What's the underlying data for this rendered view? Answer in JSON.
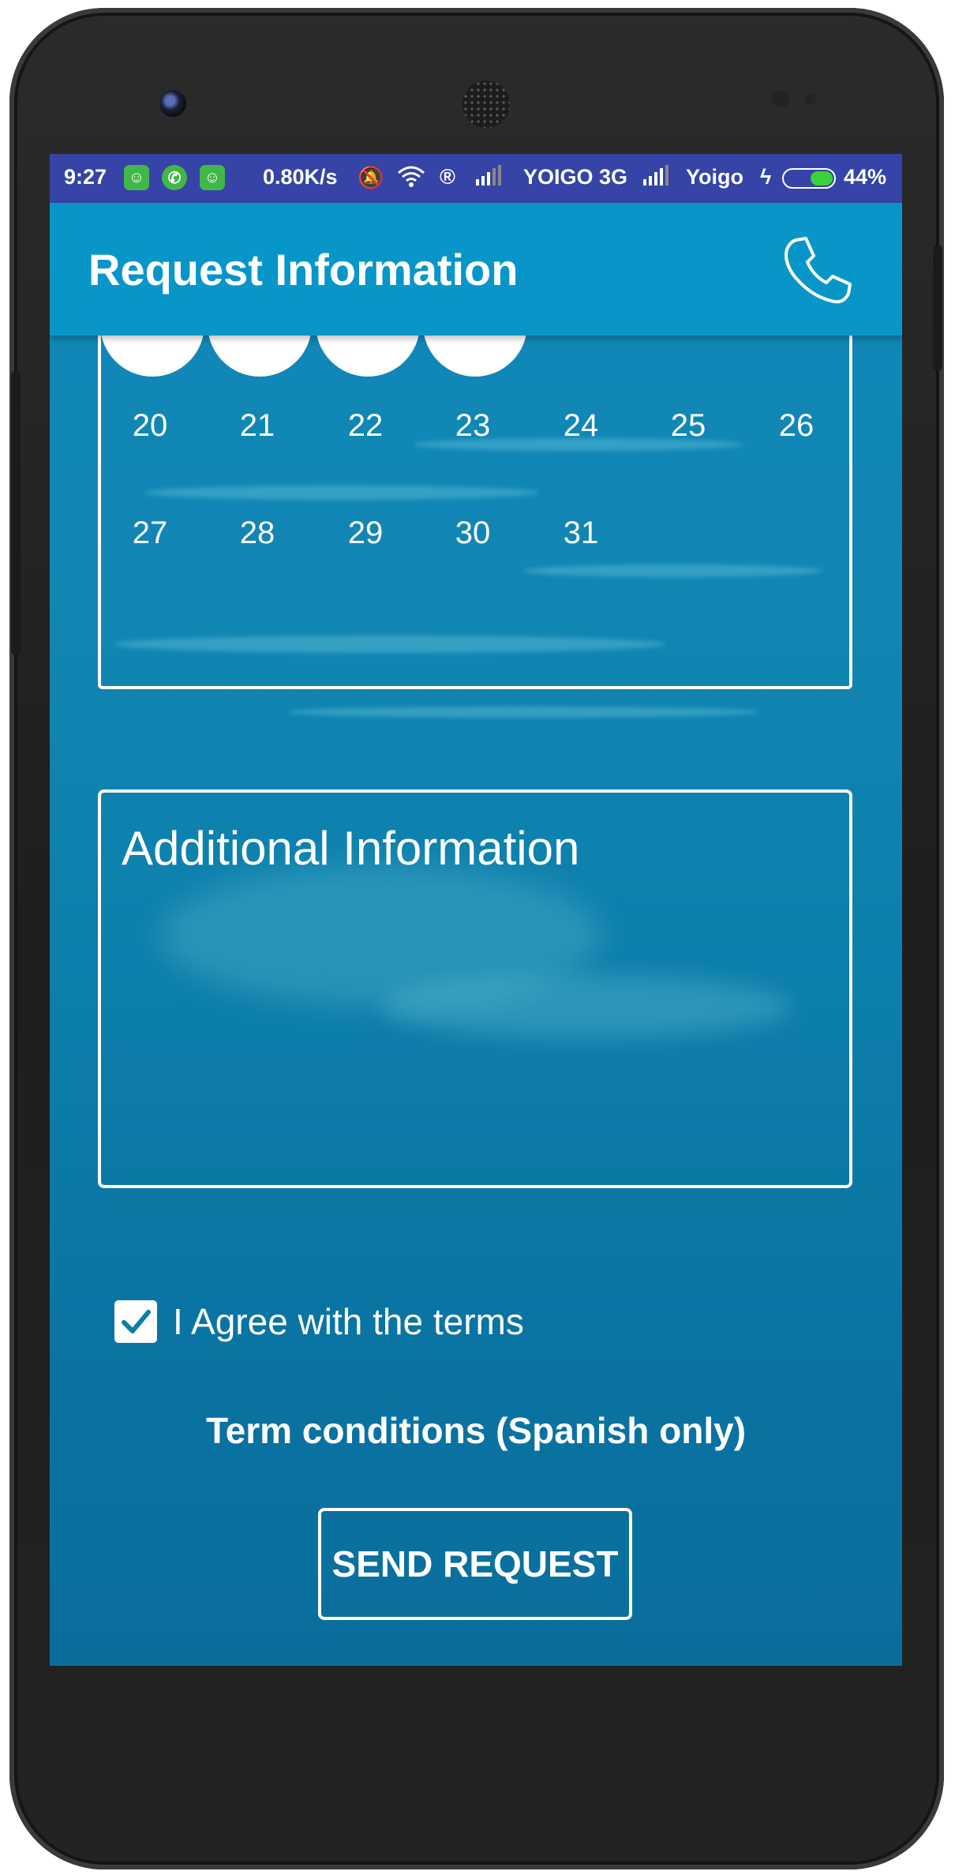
{
  "status_bar": {
    "time": "9:27",
    "speed": "0.80K/s",
    "carrier1": "YOIGO 3G",
    "carrier2": "Yoigo",
    "battery": "44%",
    "battery_level": 0.44,
    "icons": [
      "android-icon",
      "whatsapp-icon",
      "android-icon",
      "mute-icon",
      "wifi-icon",
      "roaming-icon",
      "signal-icon",
      "signal-icon",
      "charging-icon",
      "battery-icon"
    ]
  },
  "app_bar": {
    "title": "Request Information",
    "action_icon": "phone-icon"
  },
  "calendar": {
    "week_row_1": [
      "20",
      "21",
      "22",
      "23",
      "24",
      "25",
      "26"
    ],
    "week_row_2": [
      "27",
      "28",
      "29",
      "30",
      "31"
    ],
    "selected_days_count_visible": 4
  },
  "additional_info": {
    "placeholder": "Additional Information"
  },
  "agreement": {
    "label": "I Agree with the terms",
    "checked": true
  },
  "terms_link": "Term conditions (Spanish only)",
  "send_button": "SEND REQUEST",
  "colors": {
    "status_bar": "#3544a6",
    "app_bar": "#0896c9",
    "background": "#0c7fab",
    "accent_white": "#ffffff"
  }
}
